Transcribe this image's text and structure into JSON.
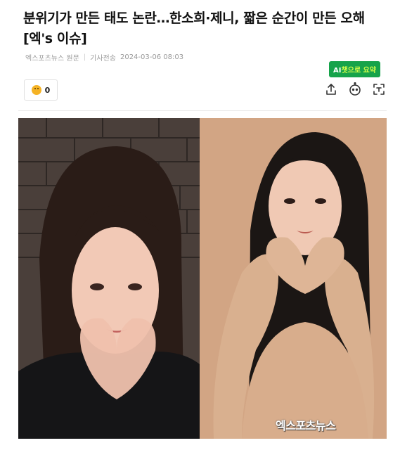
{
  "article": {
    "title": "분위기가 만든 태도 논란…한소희·제니, 짧은 순간이 만든 오해 [엑's 이슈]",
    "source": "엑스포츠뉴스 원문",
    "sent_label": "기사전송",
    "timestamp": "2024-03-06 08:03"
  },
  "ai_summary": {
    "prefix": "AI",
    "label": "챗으로 요약"
  },
  "reaction": {
    "icon": "smiley-icon",
    "count": "0"
  },
  "toolbar": {
    "share_icon": "share-icon",
    "chat_icon": "chatbot-icon",
    "text_icon": "text-scan-icon"
  },
  "photo": {
    "watermark": "엑스포츠뉴스"
  },
  "colors": {
    "ai_button_bg": "#16a34a",
    "ai_button_accent": "#d6ff4a",
    "meta_text": "#9a9a9a"
  }
}
